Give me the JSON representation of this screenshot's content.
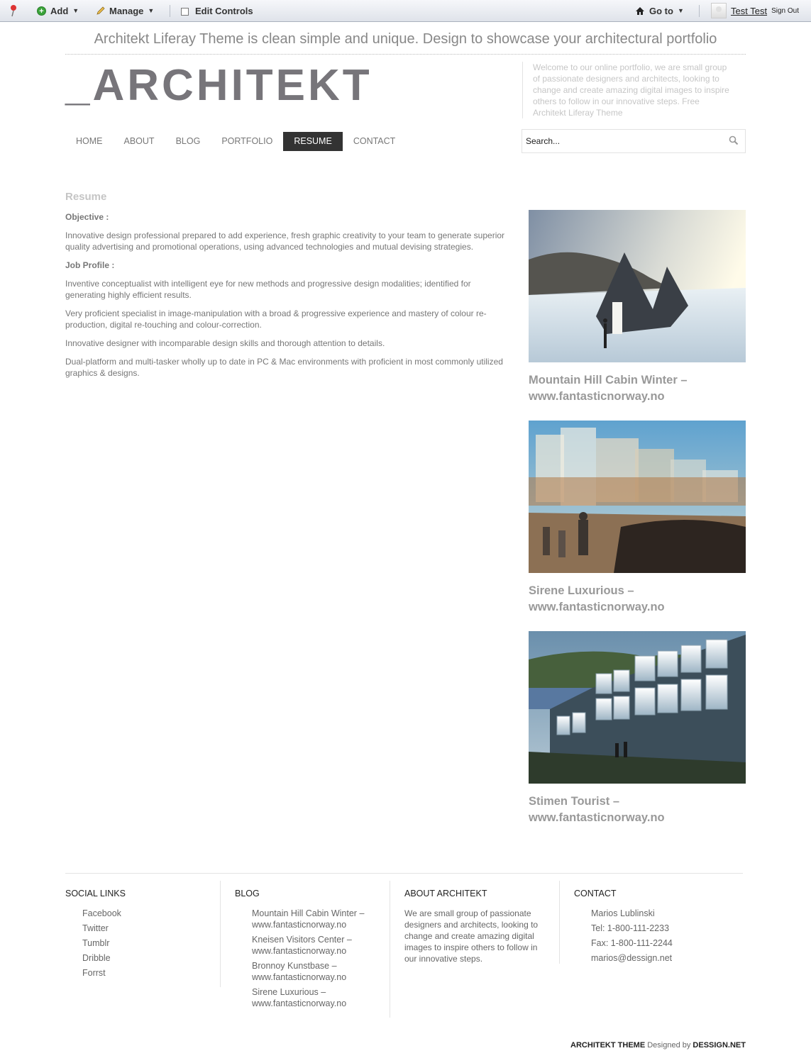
{
  "dockbar": {
    "add_label": "Add",
    "manage_label": "Manage",
    "edit_controls_label": "Edit Controls",
    "goto_label": "Go to",
    "user_name": "Test Test",
    "sign_out_label": "Sign Out"
  },
  "header": {
    "tagline": "Architekt Liferay Theme is clean simple and unique. Design to showcase your architectural portfolio",
    "logo": "_ARCHITEKT",
    "intro": "Welcome to our online portfolio, we are small group of passionate designers and architects, looking to change and create amazing digital images to inspire others to follow in our innovative steps. Free Architekt Liferay Theme"
  },
  "nav": {
    "items": [
      {
        "label": "HOME"
      },
      {
        "label": "ABOUT"
      },
      {
        "label": "BLOG"
      },
      {
        "label": "PORTFOLIO"
      },
      {
        "label": "RESUME",
        "active": true
      },
      {
        "label": "CONTACT"
      }
    ]
  },
  "search": {
    "placeholder": "Search..."
  },
  "content": {
    "title": "Resume",
    "objective_head": "Objective :",
    "objective_text": "Innovative design professional prepared to add experience, fresh graphic creativity to your team to generate superior quality advertising and promotional operations, using advanced technologies and mutual devising strategies.",
    "job_profile_head": "Job Profile :",
    "paragraphs": [
      "Inventive conceptualist with intelligent eye for new methods and progressive design modalities; identified for generating highly efficient results.",
      "Very proficient specialist in image-manipulation with a broad & progressive experience and mastery of colour re-production, digital re-touching and colour-correction.",
      "Innovative designer with incomparable design skills and thorough attention to details.",
      "Dual-platform and multi-tasker wholly up to date in PC & Mac environments with proficient in most commonly utilized graphics & designs."
    ]
  },
  "sidebar": {
    "cards": [
      {
        "title_line1": "Mountain Hill Cabin Winter –",
        "title_line2": "www.fantasticnorway.no"
      },
      {
        "title_line1": "Sirene Luxurious –",
        "title_line2": "www.fantasticnorway.no"
      },
      {
        "title_line1": "Stimen Tourist –",
        "title_line2": "www.fantasticnorway.no"
      }
    ]
  },
  "footer": {
    "social": {
      "heading": "SOCIAL LINKS",
      "links": [
        "Facebook",
        "Twitter",
        "Tumblr",
        "Dribble",
        "Forrst"
      ]
    },
    "blog": {
      "heading": "BLOG",
      "links": [
        {
          "line1": "Mountain Hill Cabin Winter –",
          "line2": "www.fantasticnorway.no"
        },
        {
          "line1": "Kneisen Visitors Center –",
          "line2": "www.fantasticnorway.no"
        },
        {
          "line1": "Bronnoy Kunstbase –",
          "line2": "www.fantasticnorway.no"
        },
        {
          "line1": "Sirene Luxurious –",
          "line2": "www.fantasticnorway.no"
        }
      ]
    },
    "about": {
      "heading": "ABOUT ARCHITEKT",
      "text": "We are small group of passionate designers and architects, looking to change and create amazing digital images to inspire others to follow in our innovative steps."
    },
    "contact": {
      "heading": "CONTACT",
      "lines": [
        "Marios Lublinski",
        "Tel: 1-800-111-2233",
        "Fax: 1-800-111-2244",
        "marios@dessign.net"
      ]
    },
    "credits": {
      "theme": "ARCHITEKT THEME",
      "designed_by": " Designed by ",
      "designer": "DESSIGN.NET"
    }
  }
}
